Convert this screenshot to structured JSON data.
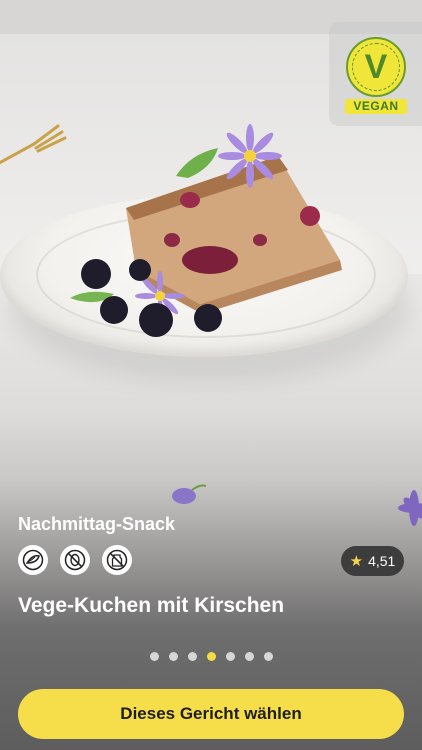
{
  "badge": {
    "label": "VEGAN",
    "mark": "V"
  },
  "dish": {
    "category": "Nachmittag-Snack",
    "title": "Vege-Kuchen mit Kirschen",
    "rating": "4,51",
    "diet_icons": [
      "vegan-leaf-icon",
      "no-nuts-icon",
      "no-milk-icon"
    ]
  },
  "pager": {
    "count": 7,
    "active_index": 3
  },
  "cta": {
    "label": "Dieses Gericht wählen"
  },
  "colors": {
    "accent": "#f6dd4a",
    "rating_bg": "#3d3d3d",
    "star": "#f7d44c"
  }
}
